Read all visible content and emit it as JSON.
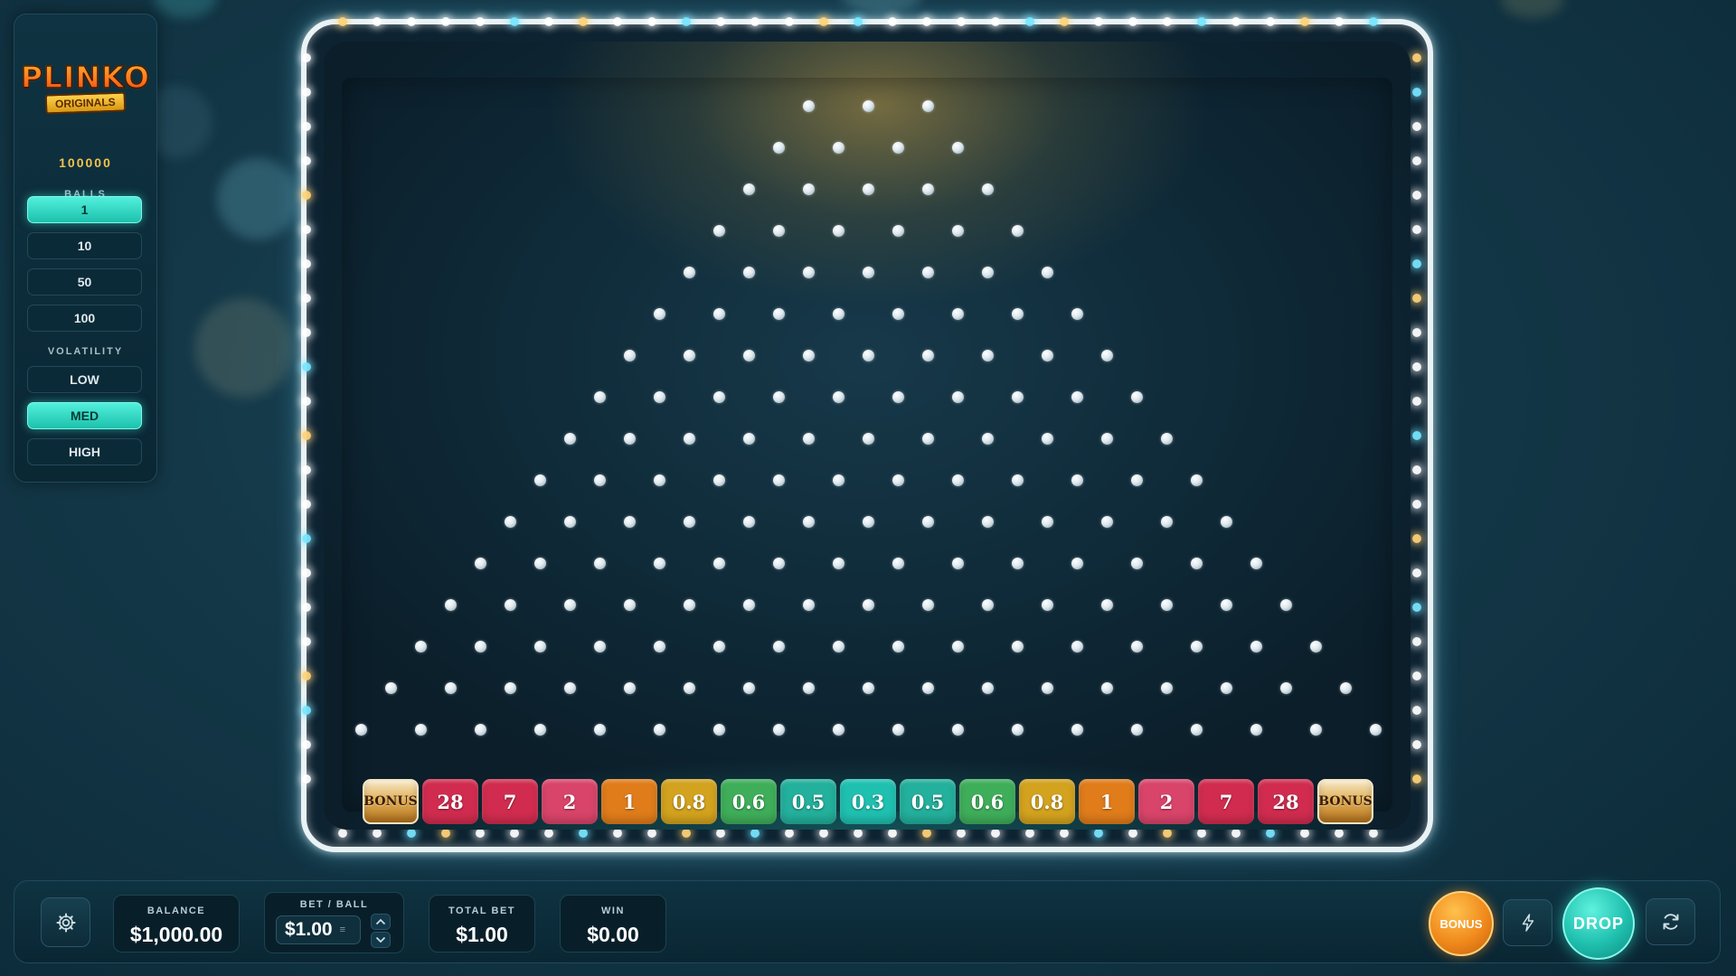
{
  "logo": {
    "title": "PLINKO",
    "subtitle": "ORIGINALS"
  },
  "panel": {
    "number": "100000",
    "balls_label": "BALLS",
    "balls_options": [
      "1",
      "10",
      "50",
      "100"
    ],
    "balls_selected": "1",
    "volatility_label": "VOLATILITY",
    "volatility_options": [
      "LOW",
      "MED",
      "HIGH"
    ],
    "volatility_selected": "MED"
  },
  "board": {
    "rows": 16,
    "multipliers": [
      "BONUS",
      "28",
      "7",
      "2",
      "1",
      "0.8",
      "0.6",
      "0.5",
      "0.3",
      "0.5",
      "0.6",
      "0.8",
      "1",
      "2",
      "7",
      "28",
      "BONUS"
    ],
    "bucket_colors": {
      "bonus": "#c98a2e",
      "red": "#d12c4f",
      "pink": "#d9446a",
      "orange": "#e07c1a",
      "yellow": "#d3a21e",
      "green": "#3fae5a",
      "teal": "#23b09c",
      "cyan": "#1fc0b0"
    }
  },
  "bottom": {
    "balance_label": "BALANCE",
    "balance_value": "$1,000.00",
    "bet_label": "BET / BALL",
    "bet_value": "$1.00",
    "total_label": "TOTAL BET",
    "total_value": "$1.00",
    "win_label": "WIN",
    "win_value": "$0.00",
    "bonus_button": "BONUS",
    "drop_button": "DROP",
    "icons": {
      "settings": "gear-icon",
      "turbo": "lightning-icon",
      "auto": "refresh-icon",
      "bet_up": "chevron-up-icon",
      "bet_down": "chevron-down-icon"
    }
  },
  "colors": {
    "accent": "#2ed3bd",
    "bonus_button": "#f08a1c",
    "drop_button": "#1fbfae",
    "gold_text": "#f2c24e"
  }
}
